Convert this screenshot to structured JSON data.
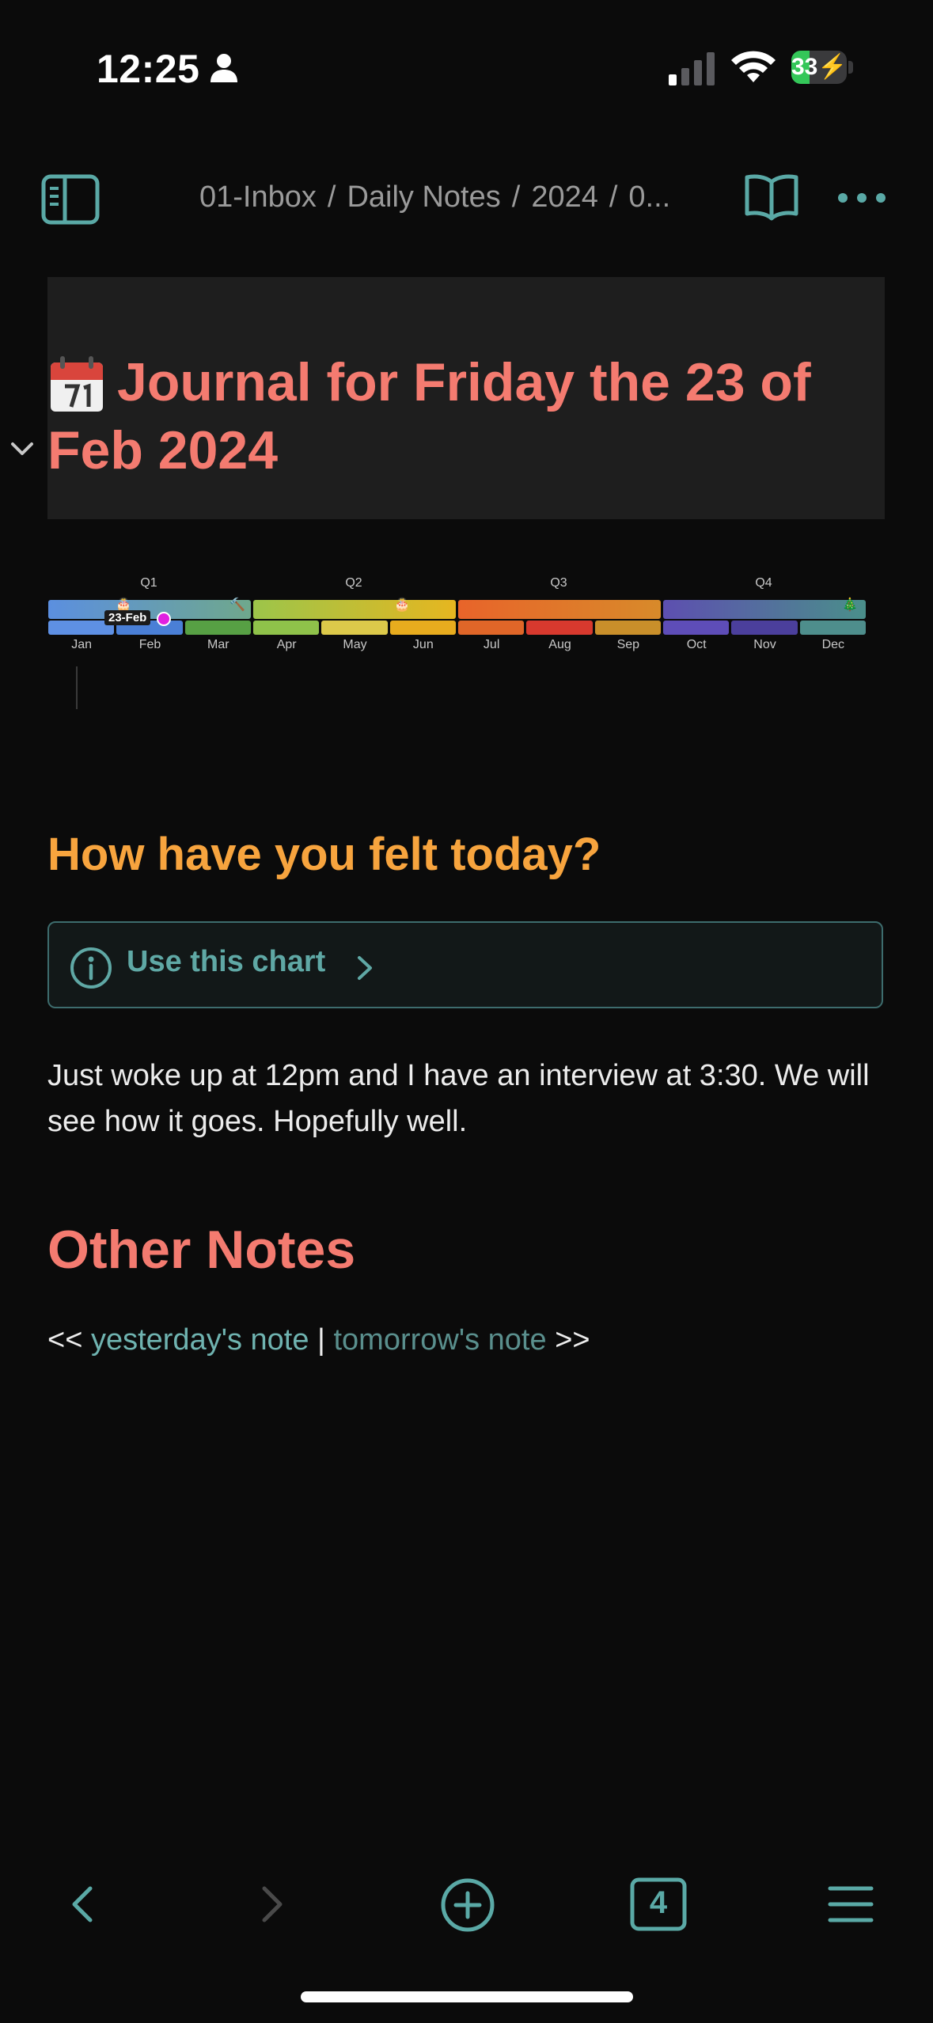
{
  "status_bar": {
    "time": "12:25",
    "battery": "33",
    "battery_level": 0.33
  },
  "topbar": {
    "breadcrumb": [
      "01-Inbox",
      "Daily Notes",
      "2024",
      "0..."
    ]
  },
  "note": {
    "title": "Journal for Friday the 23 of Feb 2024",
    "timeline": {
      "quarters": [
        "Q1",
        "Q2",
        "Q3",
        "Q4"
      ],
      "months": [
        "Jan",
        "Feb",
        "Mar",
        "Apr",
        "May",
        "Jun",
        "Jul",
        "Aug",
        "Sep",
        "Oct",
        "Nov",
        "Dec"
      ],
      "today_label": "23-Feb",
      "quarter_colors": [
        [
          "#5b8fe0",
          "#6fa88c"
        ],
        [
          "#9cc54a",
          "#e6b620"
        ],
        [
          "#e8642a",
          "#d88a2a"
        ],
        [
          "#5d4fb0",
          "#4a8f8a"
        ]
      ],
      "month_colors": [
        "#5e90e4",
        "#4a7fd6",
        "#57a044",
        "#8fc24a",
        "#dcc94a",
        "#e8ac1e",
        "#e06628",
        "#d8392e",
        "#c98f2a",
        "#5e4db8",
        "#4b3f9c",
        "#4e8e8c"
      ]
    },
    "mood_heading": "How have you felt today?",
    "callout_title": "Use this chart",
    "journal_text": "Just woke up at 12pm and I have an interview at 3:30. We will see how it goes. Hopefully well.",
    "other_notes_heading": "Other Notes",
    "nav": {
      "prefix": "<<",
      "yesterday": "yesterday's note",
      "separator": "|",
      "tomorrow": "tomorrow's note",
      "suffix": ">>"
    }
  },
  "toolbar": {
    "tabs_count": "4"
  },
  "colors": {
    "accent": "#5aa9a6",
    "title": "#f47b70",
    "heading": "#f7a43e"
  }
}
